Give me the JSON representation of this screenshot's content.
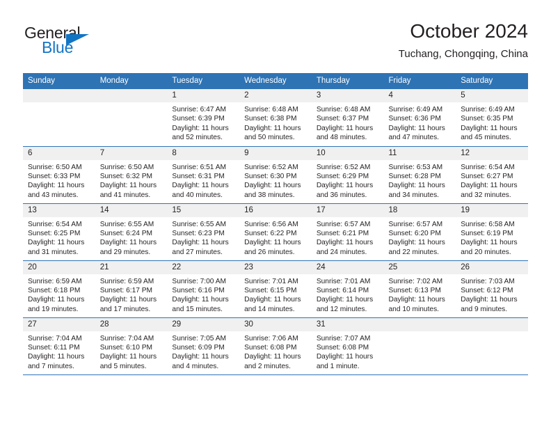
{
  "brand": {
    "name_top": "General",
    "name_bottom": "Blue",
    "triangle_color": "#1275c4",
    "top_color": "#231f20"
  },
  "header": {
    "title": "October 2024",
    "subtitle": "Tuchang, Chongqing, China",
    "accent_color": "#2e73b4"
  },
  "calendar": {
    "weekday_headers": [
      "Sunday",
      "Monday",
      "Tuesday",
      "Wednesday",
      "Thursday",
      "Friday",
      "Saturday"
    ],
    "weeks": [
      [
        {
          "day": "",
          "blank": true
        },
        {
          "day": "",
          "blank": true
        },
        {
          "day": "1",
          "sunrise": "Sunrise: 6:47 AM",
          "sunset": "Sunset: 6:39 PM",
          "daylight": "Daylight: 11 hours and 52 minutes."
        },
        {
          "day": "2",
          "sunrise": "Sunrise: 6:48 AM",
          "sunset": "Sunset: 6:38 PM",
          "daylight": "Daylight: 11 hours and 50 minutes."
        },
        {
          "day": "3",
          "sunrise": "Sunrise: 6:48 AM",
          "sunset": "Sunset: 6:37 PM",
          "daylight": "Daylight: 11 hours and 48 minutes."
        },
        {
          "day": "4",
          "sunrise": "Sunrise: 6:49 AM",
          "sunset": "Sunset: 6:36 PM",
          "daylight": "Daylight: 11 hours and 47 minutes."
        },
        {
          "day": "5",
          "sunrise": "Sunrise: 6:49 AM",
          "sunset": "Sunset: 6:35 PM",
          "daylight": "Daylight: 11 hours and 45 minutes."
        }
      ],
      [
        {
          "day": "6",
          "sunrise": "Sunrise: 6:50 AM",
          "sunset": "Sunset: 6:33 PM",
          "daylight": "Daylight: 11 hours and 43 minutes."
        },
        {
          "day": "7",
          "sunrise": "Sunrise: 6:50 AM",
          "sunset": "Sunset: 6:32 PM",
          "daylight": "Daylight: 11 hours and 41 minutes."
        },
        {
          "day": "8",
          "sunrise": "Sunrise: 6:51 AM",
          "sunset": "Sunset: 6:31 PM",
          "daylight": "Daylight: 11 hours and 40 minutes."
        },
        {
          "day": "9",
          "sunrise": "Sunrise: 6:52 AM",
          "sunset": "Sunset: 6:30 PM",
          "daylight": "Daylight: 11 hours and 38 minutes."
        },
        {
          "day": "10",
          "sunrise": "Sunrise: 6:52 AM",
          "sunset": "Sunset: 6:29 PM",
          "daylight": "Daylight: 11 hours and 36 minutes."
        },
        {
          "day": "11",
          "sunrise": "Sunrise: 6:53 AM",
          "sunset": "Sunset: 6:28 PM",
          "daylight": "Daylight: 11 hours and 34 minutes."
        },
        {
          "day": "12",
          "sunrise": "Sunrise: 6:54 AM",
          "sunset": "Sunset: 6:27 PM",
          "daylight": "Daylight: 11 hours and 32 minutes."
        }
      ],
      [
        {
          "day": "13",
          "sunrise": "Sunrise: 6:54 AM",
          "sunset": "Sunset: 6:25 PM",
          "daylight": "Daylight: 11 hours and 31 minutes."
        },
        {
          "day": "14",
          "sunrise": "Sunrise: 6:55 AM",
          "sunset": "Sunset: 6:24 PM",
          "daylight": "Daylight: 11 hours and 29 minutes."
        },
        {
          "day": "15",
          "sunrise": "Sunrise: 6:55 AM",
          "sunset": "Sunset: 6:23 PM",
          "daylight": "Daylight: 11 hours and 27 minutes."
        },
        {
          "day": "16",
          "sunrise": "Sunrise: 6:56 AM",
          "sunset": "Sunset: 6:22 PM",
          "daylight": "Daylight: 11 hours and 26 minutes."
        },
        {
          "day": "17",
          "sunrise": "Sunrise: 6:57 AM",
          "sunset": "Sunset: 6:21 PM",
          "daylight": "Daylight: 11 hours and 24 minutes."
        },
        {
          "day": "18",
          "sunrise": "Sunrise: 6:57 AM",
          "sunset": "Sunset: 6:20 PM",
          "daylight": "Daylight: 11 hours and 22 minutes."
        },
        {
          "day": "19",
          "sunrise": "Sunrise: 6:58 AM",
          "sunset": "Sunset: 6:19 PM",
          "daylight": "Daylight: 11 hours and 20 minutes."
        }
      ],
      [
        {
          "day": "20",
          "sunrise": "Sunrise: 6:59 AM",
          "sunset": "Sunset: 6:18 PM",
          "daylight": "Daylight: 11 hours and 19 minutes."
        },
        {
          "day": "21",
          "sunrise": "Sunrise: 6:59 AM",
          "sunset": "Sunset: 6:17 PM",
          "daylight": "Daylight: 11 hours and 17 minutes."
        },
        {
          "day": "22",
          "sunrise": "Sunrise: 7:00 AM",
          "sunset": "Sunset: 6:16 PM",
          "daylight": "Daylight: 11 hours and 15 minutes."
        },
        {
          "day": "23",
          "sunrise": "Sunrise: 7:01 AM",
          "sunset": "Sunset: 6:15 PM",
          "daylight": "Daylight: 11 hours and 14 minutes."
        },
        {
          "day": "24",
          "sunrise": "Sunrise: 7:01 AM",
          "sunset": "Sunset: 6:14 PM",
          "daylight": "Daylight: 11 hours and 12 minutes."
        },
        {
          "day": "25",
          "sunrise": "Sunrise: 7:02 AM",
          "sunset": "Sunset: 6:13 PM",
          "daylight": "Daylight: 11 hours and 10 minutes."
        },
        {
          "day": "26",
          "sunrise": "Sunrise: 7:03 AM",
          "sunset": "Sunset: 6:12 PM",
          "daylight": "Daylight: 11 hours and 9 minutes."
        }
      ],
      [
        {
          "day": "27",
          "sunrise": "Sunrise: 7:04 AM",
          "sunset": "Sunset: 6:11 PM",
          "daylight": "Daylight: 11 hours and 7 minutes."
        },
        {
          "day": "28",
          "sunrise": "Sunrise: 7:04 AM",
          "sunset": "Sunset: 6:10 PM",
          "daylight": "Daylight: 11 hours and 5 minutes."
        },
        {
          "day": "29",
          "sunrise": "Sunrise: 7:05 AM",
          "sunset": "Sunset: 6:09 PM",
          "daylight": "Daylight: 11 hours and 4 minutes."
        },
        {
          "day": "30",
          "sunrise": "Sunrise: 7:06 AM",
          "sunset": "Sunset: 6:08 PM",
          "daylight": "Daylight: 11 hours and 2 minutes."
        },
        {
          "day": "31",
          "sunrise": "Sunrise: 7:07 AM",
          "sunset": "Sunset: 6:08 PM",
          "daylight": "Daylight: 11 hours and 1 minute."
        },
        {
          "day": "",
          "blank": true
        },
        {
          "day": "",
          "blank": true
        }
      ]
    ]
  }
}
